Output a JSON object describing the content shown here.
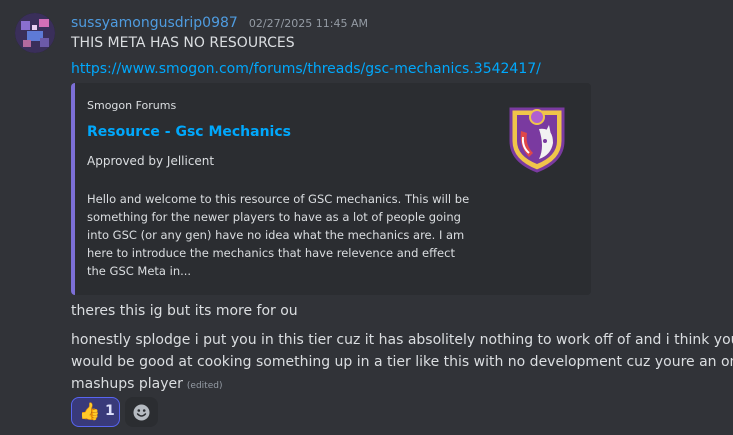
{
  "message": {
    "username": "sussyamongusdrip0987",
    "timestamp": "02/27/2025 11:45 AM",
    "line1": "THIS META HAS NO RESOURCES",
    "link": "https://www.smogon.com/forums/threads/gsc-mechanics.3542417/",
    "line2": "theres this ig but its more for ou",
    "line3_parts": [
      "honestly splodge i put you in this tier cuz it has absolitely nothing to work off of and i think you",
      "would be good at cooking something up in a tier like this with no development cuz youre an om",
      "mashups player"
    ],
    "edited": "(edited)"
  },
  "embed": {
    "provider": "Smogon Forums",
    "title": "Resource - Gsc Mechanics",
    "approved": "Approved by Jellicent",
    "description_lines": [
      "Hello and welcome to this resource of GSC mechanics. This will be",
      "something for the newer players to have as a lot of people going",
      "into GSC (or any gen) have no idea what the mechanics are. I am",
      "here to introduce the mechanics that have relevence and effect",
      "the GSC Meta in..."
    ],
    "accent_color": "#7c6fd6"
  },
  "reactions": [
    {
      "emoji": "👍",
      "emoji_name": "thumbs-up",
      "count": "1"
    }
  ],
  "icons": {
    "avatar": "user-avatar",
    "add_reaction": "add-reaction-smiley-icon",
    "thumbnail": "smogon-logo"
  },
  "colors": {
    "username": "#4f9ce0",
    "link": "#00a8fc",
    "background": "#313338",
    "embed_bg": "#2b2d31",
    "reaction_active_bg": "#393a7a",
    "reaction_active_border": "#5865f2"
  }
}
